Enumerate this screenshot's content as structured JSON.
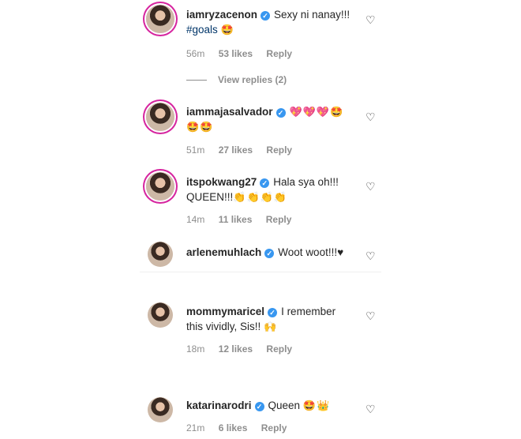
{
  "comments": [
    {
      "username": "iamryzacenon",
      "text": "Sexy ni nanay!!!",
      "hashtag": "#goals",
      "emoji": "🤩",
      "time": "56m",
      "likes": "53 likes",
      "reply": "Reply",
      "view_replies": "View replies (2)"
    },
    {
      "username": "iammajasalvador",
      "text": "",
      "emoji": "💖💖💖🤩",
      "emoji2": "🤩🤩",
      "time": "51m",
      "likes": "27 likes",
      "reply": "Reply"
    },
    {
      "username": "itspokwang27",
      "text": "Hala sya oh!!!",
      "text2": "QUEEN!!!",
      "emoji": "👏👏👏👏",
      "time": "14m",
      "likes": "11 likes",
      "reply": "Reply"
    },
    {
      "username": "arlenemuhlach",
      "text": "Woot woot!!!♥"
    },
    {
      "username": "mommymaricel",
      "text": "I remember",
      "text2": "this vividly, Sis!!",
      "emoji": "🙌",
      "time": "18m",
      "likes": "12 likes",
      "reply": "Reply"
    },
    {
      "username": "katarinarodri",
      "text": "Queen",
      "emoji": "🤩👑",
      "time": "21m",
      "likes": "6 likes",
      "reply": "Reply"
    }
  ],
  "verified_glyph": "✓",
  "heart_icon": "♡"
}
